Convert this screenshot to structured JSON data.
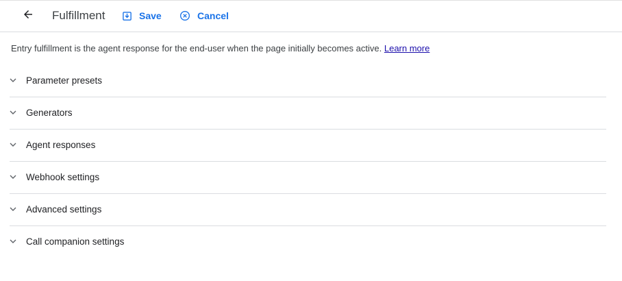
{
  "header": {
    "title": "Fulfillment",
    "save_label": "Save",
    "cancel_label": "Cancel"
  },
  "description": {
    "text": "Entry fulfillment is the agent response for the end-user when the page initially becomes active. ",
    "link_label": "Learn more"
  },
  "sections": [
    {
      "label": "Parameter presets"
    },
    {
      "label": "Generators"
    },
    {
      "label": "Agent responses"
    },
    {
      "label": "Webhook settings"
    },
    {
      "label": "Advanced settings"
    },
    {
      "label": "Call companion settings"
    }
  ],
  "colors": {
    "accent": "#1a73e8",
    "link": "#1a0dab",
    "divider": "#dadce0",
    "text": "#202124"
  },
  "icons": {
    "back": "arrow-back-icon",
    "save": "save-icon",
    "cancel": "cancel-icon",
    "expand": "chevron-down-icon"
  }
}
